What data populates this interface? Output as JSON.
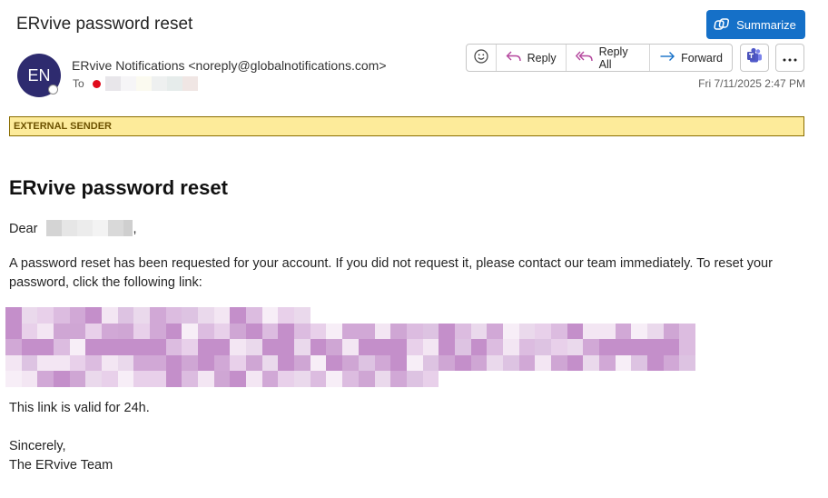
{
  "email": {
    "subject": "ERvive password reset",
    "summarize_label": "Summarize",
    "avatar_initials": "EN",
    "sender": "ERvive Notifications <noreply@globalnotifications.com>",
    "to_label": "To",
    "date": "Fri 7/11/2025 2:47 PM",
    "actions": {
      "reply": "Reply",
      "reply_all": "Reply All",
      "forward": "Forward"
    },
    "external_banner": "EXTERNAL SENDER"
  },
  "body": {
    "title": "ERvive password reset",
    "greeting_prefix": "Dear",
    "greeting_suffix": ",",
    "paragraph": "A password reset has been requested for your account. If you did not request it, please contact our team immediately. To reset your password, click the following link:",
    "validity": "This link is valid for 24h.",
    "signoff_line1": "Sincerely,",
    "signoff_line2": "The ERvive Team"
  },
  "colors": {
    "accent": "#1570c8",
    "avatar": "#2e2b6f",
    "banner_bg": "#fdeb9a",
    "banner_border": "#8a6d00",
    "presence_busy": "#e00b1c"
  },
  "icons": {
    "summarize": "copilot-icon",
    "emoji": "smiley-icon",
    "reply": "reply-arrow-icon",
    "reply_all": "reply-all-arrow-icon",
    "forward": "forward-arrow-icon",
    "teams": "teams-icon",
    "more": "ellipsis-icon"
  }
}
